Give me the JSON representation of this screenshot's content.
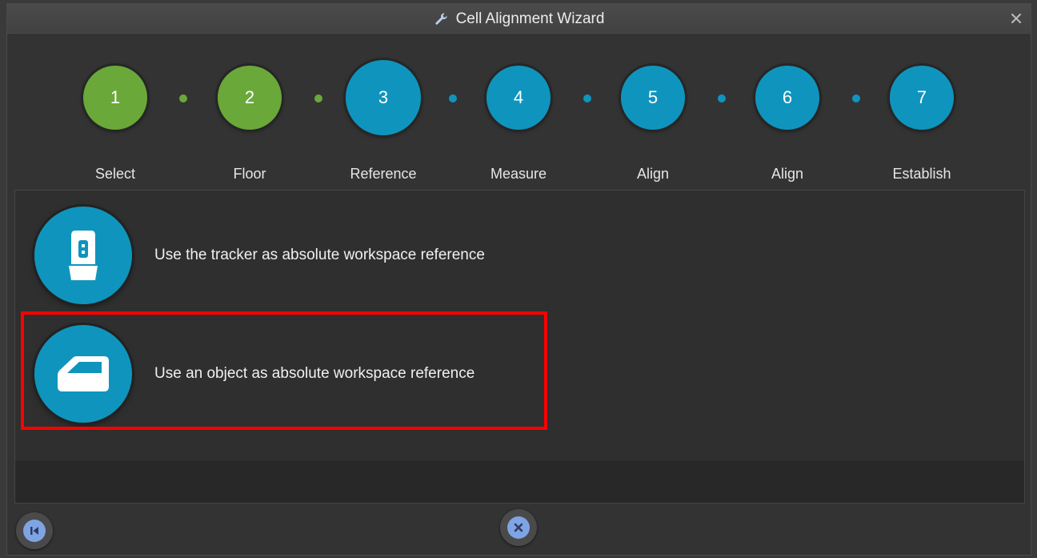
{
  "window": {
    "title": "Cell Alignment Wizard",
    "title_icon": "wrench-icon",
    "close_glyph": "×"
  },
  "steps": [
    {
      "number": "1",
      "label": "Select",
      "state": "complete",
      "color": "#6aa83a"
    },
    {
      "number": "2",
      "label": "Floor",
      "state": "complete",
      "color": "#6aa83a"
    },
    {
      "number": "3",
      "label": "Reference",
      "state": "current",
      "color": "#0f95bd"
    },
    {
      "number": "4",
      "label": "Measure",
      "state": "pending",
      "color": "#0f95bd"
    },
    {
      "number": "5",
      "label": "Align",
      "state": "pending",
      "color": "#0f95bd"
    },
    {
      "number": "6",
      "label": "Align",
      "state": "pending",
      "color": "#0f95bd"
    },
    {
      "number": "7",
      "label": "Establish",
      "state": "pending",
      "color": "#0f95bd"
    }
  ],
  "options": [
    {
      "icon": "tracker-icon",
      "text": "Use the tracker as absolute workspace reference"
    },
    {
      "icon": "object-icon",
      "text": "Use an object as absolute workspace reference",
      "highlighted": true
    }
  ],
  "footer": {
    "back_icon": "skip-back-icon",
    "cancel_icon": "cancel-icon"
  },
  "colors": {
    "complete": "#6aa83a",
    "pending": "#0f95bd",
    "highlight": "#ff0000"
  }
}
